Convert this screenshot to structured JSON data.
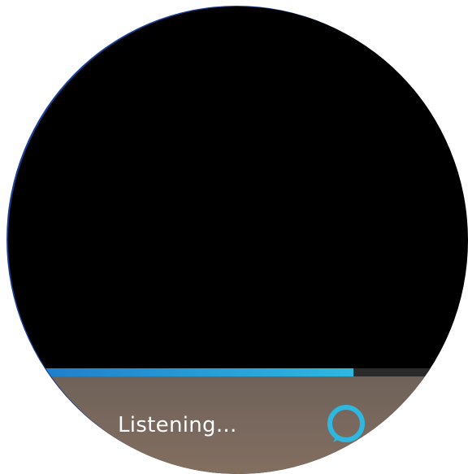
{
  "voice_assistant": {
    "status_text": "Listening...",
    "progress": 0.75,
    "icon": "alexa-ring-icon"
  },
  "colors": {
    "background": "#000000",
    "accent": "#2eb8e0",
    "progress_track": "#2a2a2a",
    "bottom_bar": "#7c6a5f",
    "text": "#ffffff"
  }
}
